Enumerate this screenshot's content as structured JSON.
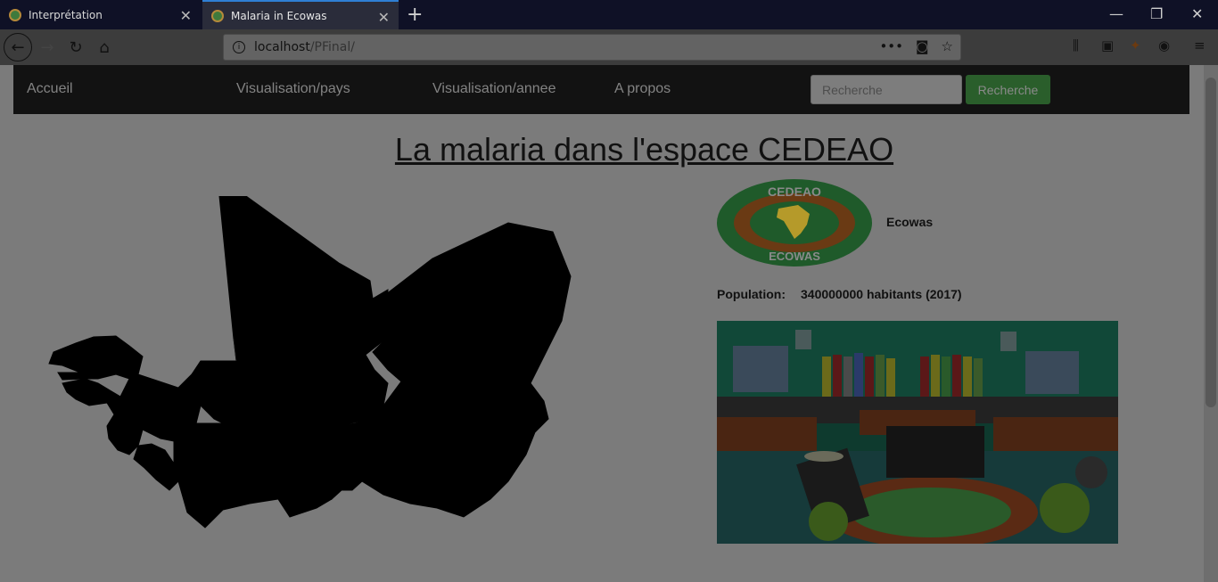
{
  "browser": {
    "tabs": [
      {
        "title": "Interprétation"
      },
      {
        "title": "Malaria in Ecowas"
      }
    ],
    "url_host": "localhost",
    "url_path": "/PFinal/"
  },
  "nav": {
    "items": [
      {
        "label": "Accueil"
      },
      {
        "label": "Visualisation/pays"
      },
      {
        "label": "Visualisation/annee"
      },
      {
        "label": "A propos"
      }
    ],
    "search_placeholder": "Recherche",
    "search_button": "Recherche"
  },
  "main": {
    "title": "La malaria dans l'espace CEDEAO",
    "org_name": "Ecowas",
    "logo_top_text": "CEDEAO",
    "logo_bottom_text": "ECOWAS",
    "population_label": "Population:",
    "population_value": "340000000 habitants (2017)"
  }
}
